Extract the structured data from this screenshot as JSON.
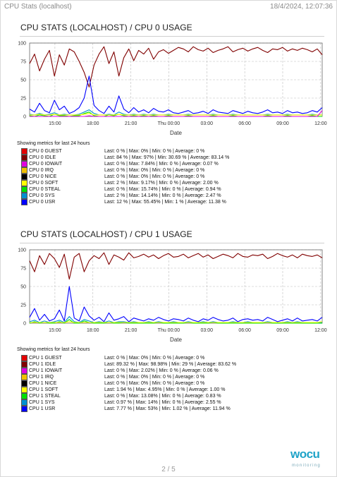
{
  "header": {
    "title": "CPU Stats (localhost)",
    "date": "18/4/2024, 12:07:36"
  },
  "footer": {
    "page": "2 / 5",
    "logo_text": "wocu",
    "logo_sub": "monitoring"
  },
  "colors": {
    "guest": "#e30000",
    "idle": "#800000",
    "iowait": "#e000e0",
    "irq": "#f0c000",
    "nice": "#000000",
    "soft": "#ffff00",
    "steal": "#00e000",
    "sys": "#0090d0",
    "usr": "#0000ff"
  },
  "sections": [
    {
      "title": "CPU STATS (LOCALHOST) / CPU 0 USAGE",
      "legend_caption": "Showing metrics for last 24 hours",
      "legend": [
        {
          "name": "CPU 0 GUEST",
          "color_key": "guest",
          "stats": "Last: 0 % | Max: 0% | Min: 0 % | Average: 0 %"
        },
        {
          "name": "CPU 0 IDLE",
          "color_key": "idle",
          "stats": "Last: 84 % | Max: 97% | Min: 30.69 % | Average: 83.14 %"
        },
        {
          "name": "CPU 0 IOWAIT",
          "color_key": "iowait",
          "stats": "Last: 0 % | Max: 7.84% | Min: 0 % | Average: 0.07 %"
        },
        {
          "name": "CPU 0 IRQ",
          "color_key": "irq",
          "stats": "Last: 0 % | Max: 0% | Min: 0 % | Average: 0 %"
        },
        {
          "name": "CPU 0 NICE",
          "color_key": "nice",
          "stats": "Last: 0 % | Max: 0% | Min: 0 % | Average: 0 %"
        },
        {
          "name": "CPU 0 SOFT",
          "color_key": "soft",
          "stats": "Last: 2 % | Max: 9.17% | Min: 0 % | Average: 2.00 %"
        },
        {
          "name": "CPU 0 STEAL",
          "color_key": "steal",
          "stats": "Last: 0 % | Max: 15.74% | Min: 0 % | Average: 0.94 %"
        },
        {
          "name": "CPU 0 SYS",
          "color_key": "sys",
          "stats": "Last: 2 % | Max: 14.14% | Min: 0 % | Average: 2.47 %"
        },
        {
          "name": "CPU 0 USR",
          "color_key": "usr",
          "stats": "Last: 12 % | Max: 55.45% | Min: 1 % | Average: 11.38 %"
        }
      ]
    },
    {
      "title": "CPU STATS (LOCALHOST) / CPU 1 USAGE",
      "legend_caption": "Showing metrics for last 24 hours",
      "legend": [
        {
          "name": "CPU 1 GUEST",
          "color_key": "guest",
          "stats": "Last: 0 % | Max: 0% | Min: 0 % | Average: 0 %"
        },
        {
          "name": "CPU 1 IDLE",
          "color_key": "idle",
          "stats": "Last: 89.32 % | Max: 98.98% | Min: 29 % | Average: 83.62 %"
        },
        {
          "name": "CPU 1 IOWAIT",
          "color_key": "iowait",
          "stats": "Last: 0 % | Max: 2.02% | Min: 0 % | Average: 0.06 %"
        },
        {
          "name": "CPU 1 IRQ",
          "color_key": "irq",
          "stats": "Last: 0 % | Max: 0% | Min: 0 % | Average: 0 %"
        },
        {
          "name": "CPU 1 NICE",
          "color_key": "nice",
          "stats": "Last: 0 % | Max: 0% | Min: 0 % | Average: 0 %"
        },
        {
          "name": "CPU 1 SOFT",
          "color_key": "soft",
          "stats": "Last: 1.94 % | Max: 4.95% | Min: 0 % | Average: 1.00 %"
        },
        {
          "name": "CPU 1 STEAL",
          "color_key": "steal",
          "stats": "Last: 0 % | Max: 13.08% | Min: 0 % | Average: 0.83 %"
        },
        {
          "name": "CPU 1 SYS",
          "color_key": "sys",
          "stats": "Last: 0.97 % | Max: 14% | Min: 0 % | Average: 2.55 %"
        },
        {
          "name": "CPU 1 USR",
          "color_key": "usr",
          "stats": "Last: 7.77 % | Max: 53% | Min: 1.02 % | Average: 11.94 %"
        }
      ]
    }
  ],
  "chart_data": [
    {
      "type": "line",
      "xlabel": "Date",
      "ylabel": "",
      "ylim": [
        0,
        100
      ],
      "y_ticks": [
        "0",
        "25",
        "50",
        "75",
        "100"
      ],
      "x_ticks": [
        "15:00",
        "18:00",
        "21:00",
        "Thu 00:00",
        "03:00",
        "06:00",
        "09:00",
        "12:00"
      ],
      "grid": true,
      "series": [
        {
          "name": "CPU 0 IDLE",
          "color_key": "idle",
          "x_range": [
            "13:00",
            "12:07"
          ],
          "values": [
            72,
            85,
            62,
            78,
            90,
            55,
            84,
            70,
            92,
            88,
            75,
            60,
            40,
            70,
            85,
            95,
            72,
            88,
            55,
            80,
            92,
            76,
            90,
            85,
            93,
            78,
            88,
            91,
            86,
            90,
            94,
            92,
            88,
            95,
            91,
            89,
            93,
            87,
            90,
            92,
            95,
            88,
            91,
            93,
            89,
            92,
            94,
            90,
            87,
            92,
            91,
            94,
            89,
            92,
            90,
            93,
            91,
            88,
            92,
            84
          ]
        },
        {
          "name": "CPU 0 USR",
          "color_key": "usr",
          "x_range": [
            "13:00",
            "12:07"
          ],
          "values": [
            10,
            6,
            18,
            8,
            5,
            22,
            9,
            14,
            4,
            7,
            12,
            25,
            55,
            15,
            8,
            4,
            14,
            6,
            28,
            10,
            5,
            12,
            6,
            9,
            5,
            11,
            7,
            6,
            9,
            5,
            4,
            6,
            8,
            4,
            5,
            7,
            4,
            9,
            6,
            5,
            4,
            8,
            6,
            4,
            7,
            5,
            4,
            6,
            9,
            5,
            6,
            4,
            8,
            5,
            6,
            4,
            5,
            8,
            6,
            12
          ]
        },
        {
          "name": "CPU 0 SYS",
          "color_key": "sys",
          "x_range": [
            "13:00",
            "12:07"
          ],
          "values": [
            3,
            2,
            4,
            2,
            3,
            5,
            2,
            3,
            2,
            2,
            3,
            6,
            9,
            4,
            2,
            2,
            3,
            2,
            6,
            3,
            2,
            3,
            2,
            3,
            2,
            3,
            2,
            2,
            3,
            2,
            2,
            2,
            3,
            2,
            2,
            2,
            2,
            3,
            2,
            2,
            2,
            3,
            2,
            2,
            2,
            2,
            2,
            2,
            3,
            2,
            2,
            2,
            3,
            2,
            2,
            2,
            2,
            3,
            2,
            2
          ]
        },
        {
          "name": "CPU 0 STEAL",
          "color_key": "steal",
          "x_range": [
            "13:00",
            "12:07"
          ],
          "values": [
            1,
            0,
            2,
            1,
            0,
            3,
            1,
            1,
            0,
            1,
            1,
            4,
            6,
            1,
            0,
            0,
            2,
            1,
            3,
            1,
            0,
            1,
            0,
            1,
            0,
            1,
            0,
            0,
            1,
            0,
            0,
            0,
            1,
            0,
            0,
            0,
            0,
            1,
            0,
            0,
            0,
            1,
            0,
            0,
            0,
            0,
            0,
            0,
            1,
            0,
            0,
            0,
            1,
            0,
            0,
            0,
            0,
            1,
            0,
            0
          ]
        },
        {
          "name": "CPU 0 SOFT",
          "color_key": "soft",
          "x_range": [
            "13:00",
            "12:07"
          ],
          "values": [
            2,
            2,
            3,
            2,
            2,
            3,
            2,
            2,
            2,
            2,
            2,
            3,
            4,
            2,
            2,
            2,
            2,
            2,
            3,
            2,
            2,
            2,
            2,
            2,
            2,
            2,
            2,
            2,
            2,
            2,
            2,
            2,
            2,
            2,
            2,
            2,
            2,
            2,
            2,
            2,
            2,
            2,
            2,
            2,
            2,
            2,
            2,
            2,
            2,
            2,
            2,
            2,
            2,
            2,
            2,
            2,
            2,
            2,
            2,
            2
          ]
        },
        {
          "name": "CPU 0 IOWAIT",
          "color_key": "iowait",
          "x_range": [
            "13:00",
            "12:07"
          ],
          "values": [
            0,
            0,
            0,
            0,
            0,
            0,
            0,
            0,
            0,
            0,
            0,
            0,
            1,
            0,
            0,
            0,
            0,
            0,
            0,
            0,
            0,
            0,
            0,
            0,
            0,
            0,
            0,
            0,
            0,
            0,
            0,
            0,
            0,
            0,
            0,
            0,
            0,
            0,
            0,
            0,
            0,
            0,
            0,
            0,
            0,
            0,
            0,
            0,
            0,
            0,
            0,
            0,
            0,
            0,
            0,
            0,
            0,
            0,
            0,
            8
          ]
        }
      ]
    },
    {
      "type": "line",
      "xlabel": "Date",
      "ylabel": "",
      "ylim": [
        0,
        100
      ],
      "y_ticks": [
        "0",
        "25",
        "50",
        "75",
        "100"
      ],
      "x_ticks": [
        "15:00",
        "18:00",
        "21:00",
        "Thu 00:00",
        "03:00",
        "06:00",
        "09:00",
        "12:00"
      ],
      "grid": true,
      "series": [
        {
          "name": "CPU 1 IDLE",
          "color_key": "idle",
          "x_range": [
            "13:00",
            "12:07"
          ],
          "values": [
            85,
            70,
            92,
            80,
            95,
            88,
            76,
            94,
            60,
            90,
            95,
            70,
            85,
            92,
            88,
            96,
            80,
            93,
            90,
            86,
            96,
            89,
            91,
            94,
            90,
            93,
            88,
            92,
            95,
            90,
            91,
            94,
            89,
            92,
            95,
            90,
            93,
            88,
            91,
            94,
            92,
            89,
            95,
            91,
            90,
            93,
            92,
            94,
            88,
            91,
            95,
            92,
            90,
            93,
            89,
            94,
            92,
            91,
            93,
            89
          ]
        },
        {
          "name": "CPU 1 USR",
          "color_key": "usr",
          "x_range": [
            "13:00",
            "12:07"
          ],
          "values": [
            8,
            20,
            4,
            12,
            3,
            6,
            18,
            3,
            50,
            7,
            3,
            22,
            10,
            4,
            8,
            2,
            14,
            4,
            6,
            9,
            2,
            7,
            5,
            3,
            6,
            4,
            8,
            5,
            3,
            6,
            5,
            3,
            7,
            4,
            2,
            6,
            4,
            8,
            5,
            3,
            4,
            7,
            2,
            5,
            6,
            4,
            5,
            3,
            8,
            5,
            2,
            4,
            6,
            3,
            7,
            3,
            4,
            5,
            3,
            8
          ]
        },
        {
          "name": "CPU 1 SYS",
          "color_key": "sys",
          "x_range": [
            "13:00",
            "12:07"
          ],
          "values": [
            2,
            4,
            1,
            3,
            1,
            2,
            4,
            1,
            9,
            2,
            1,
            5,
            3,
            1,
            2,
            1,
            3,
            1,
            2,
            2,
            1,
            2,
            1,
            1,
            2,
            1,
            2,
            1,
            1,
            2,
            1,
            1,
            2,
            1,
            1,
            2,
            1,
            2,
            1,
            1,
            1,
            2,
            1,
            1,
            2,
            1,
            1,
            1,
            2,
            1,
            1,
            1,
            2,
            1,
            2,
            1,
            1,
            1,
            1,
            1
          ]
        },
        {
          "name": "CPU 1 STEAL",
          "color_key": "steal",
          "x_range": [
            "13:00",
            "12:07"
          ],
          "values": [
            0,
            2,
            0,
            1,
            0,
            0,
            2,
            0,
            5,
            0,
            0,
            3,
            1,
            0,
            0,
            0,
            1,
            0,
            0,
            1,
            0,
            0,
            0,
            0,
            0,
            0,
            1,
            0,
            0,
            0,
            0,
            0,
            1,
            0,
            0,
            0,
            0,
            1,
            0,
            0,
            0,
            0,
            0,
            0,
            0,
            0,
            0,
            0,
            1,
            0,
            0,
            0,
            0,
            0,
            0,
            0,
            0,
            0,
            0,
            0
          ]
        },
        {
          "name": "CPU 1 SOFT",
          "color_key": "soft",
          "x_range": [
            "13:00",
            "12:07"
          ],
          "values": [
            1,
            1,
            1,
            1,
            1,
            1,
            1,
            1,
            2,
            1,
            1,
            1,
            1,
            1,
            1,
            1,
            1,
            1,
            1,
            1,
            1,
            1,
            1,
            1,
            1,
            1,
            1,
            1,
            1,
            1,
            1,
            1,
            1,
            1,
            1,
            1,
            1,
            1,
            1,
            1,
            1,
            1,
            1,
            1,
            1,
            1,
            1,
            1,
            1,
            1,
            1,
            1,
            1,
            1,
            1,
            1,
            1,
            1,
            1,
            2
          ]
        }
      ]
    }
  ]
}
